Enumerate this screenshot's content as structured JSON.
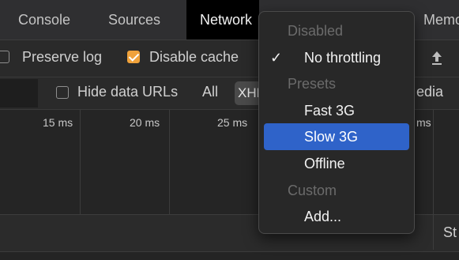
{
  "tabs": [
    {
      "label": "Console"
    },
    {
      "label": "Sources"
    },
    {
      "label": "Network"
    },
    {
      "label": "Memo"
    }
  ],
  "toolbar": {
    "preserve_log": {
      "label": "Preserve log",
      "checked": false
    },
    "disable_cache": {
      "label": "Disable cache",
      "checked": true
    },
    "upload_icon": "upload-arrow-icon"
  },
  "filter_row": {
    "hide_data_urls": {
      "label": "Hide data URLs",
      "checked": false
    },
    "all_label": "All",
    "xhr_label": "XHR",
    "media_label": "edia"
  },
  "timeline": {
    "ticks": [
      "15 ms",
      "20 ms",
      "25 ms",
      "ms"
    ]
  },
  "grid": {
    "status_col": "St"
  },
  "throttle_menu": {
    "disabled_header": "Disabled",
    "no_throttling": "No throttling",
    "presets_header": "Presets",
    "fast3g": "Fast 3G",
    "slow3g": "Slow 3G",
    "offline": "Offline",
    "custom_header": "Custom",
    "add": "Add...",
    "selected": "Slow 3G",
    "checked": "No throttling",
    "highlight_color": "#2f63c9"
  }
}
